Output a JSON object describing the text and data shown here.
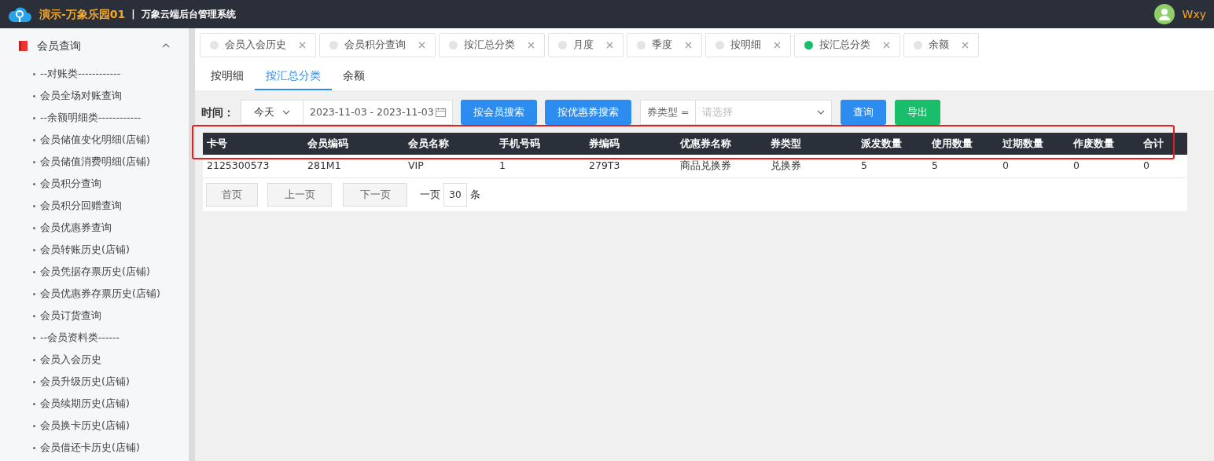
{
  "header": {
    "brand": "演示-万象乐园01",
    "separator": "|",
    "system": "万象云端后台管理系统",
    "user": "Wxy"
  },
  "sidebar": {
    "group": {
      "label": "会员查询",
      "expanded": true
    },
    "items": [
      {
        "label": "--对账类------------"
      },
      {
        "label": "会员全场对账查询"
      },
      {
        "label": "--余额明细类------------"
      },
      {
        "label": "会员储值变化明细(店铺)"
      },
      {
        "label": "会员储值消费明细(店铺)"
      },
      {
        "label": "会员积分查询"
      },
      {
        "label": "会员积分回赠查询"
      },
      {
        "label": "会员优惠券查询"
      },
      {
        "label": "会员转账历史(店铺)"
      },
      {
        "label": "会员凭据存票历史(店铺)"
      },
      {
        "label": "会员优惠券存票历史(店铺)"
      },
      {
        "label": "会员订货查询"
      },
      {
        "label": "--会员资料类------"
      },
      {
        "label": "会员入会历史"
      },
      {
        "label": "会员升级历史(店铺)"
      },
      {
        "label": "会员续期历史(店铺)"
      },
      {
        "label": "会员换卡历史(店铺)"
      },
      {
        "label": "会员借还卡历史(店铺)"
      }
    ]
  },
  "tabs": [
    {
      "label": "会员入会历史",
      "selected": false
    },
    {
      "label": "会员积分查询",
      "selected": false
    },
    {
      "label": "按汇总分类",
      "selected": false
    },
    {
      "label": "月度",
      "selected": false
    },
    {
      "label": "季度",
      "selected": false
    },
    {
      "label": "按明细",
      "selected": false
    },
    {
      "label": "按汇总分类",
      "selected": true
    },
    {
      "label": "余额",
      "selected": false
    }
  ],
  "subtabs": [
    {
      "label": "按明细",
      "selected": false
    },
    {
      "label": "按汇总分类",
      "selected": true
    },
    {
      "label": "余额",
      "selected": false
    }
  ],
  "filters": {
    "time_label": "时间：",
    "period": "今天",
    "date_range": "2023-11-03 - 2023-11-03",
    "buttons": [
      {
        "label": "按会员搜索",
        "kind": "primary"
      },
      {
        "label": "按优惠券搜索",
        "kind": "primary"
      }
    ],
    "type_prefix": "券类型 =",
    "type_placeholder": "请选择",
    "actions": [
      {
        "label": "查询",
        "kind": "primary"
      },
      {
        "label": "导出",
        "kind": "success"
      }
    ]
  },
  "table": {
    "header_highlighted": true,
    "columns": [
      "卡号",
      "会员编码",
      "会员名称",
      "手机号码",
      "券编码",
      "优惠券名称",
      "券类型",
      "派发数量",
      "使用数量",
      "过期数量",
      "作废数量",
      "合计"
    ],
    "rows": [
      [
        "2125300573",
        "281M1",
        "VIP",
        "1",
        "279T3",
        "商品兑换券",
        "兑换券",
        "5",
        "5",
        "0",
        "0",
        "0"
      ]
    ]
  },
  "pager": {
    "first": "首页",
    "prev": "上一页",
    "next": "下一页",
    "per_page_label": "一页",
    "per_page": "30",
    "unit": "条"
  }
}
